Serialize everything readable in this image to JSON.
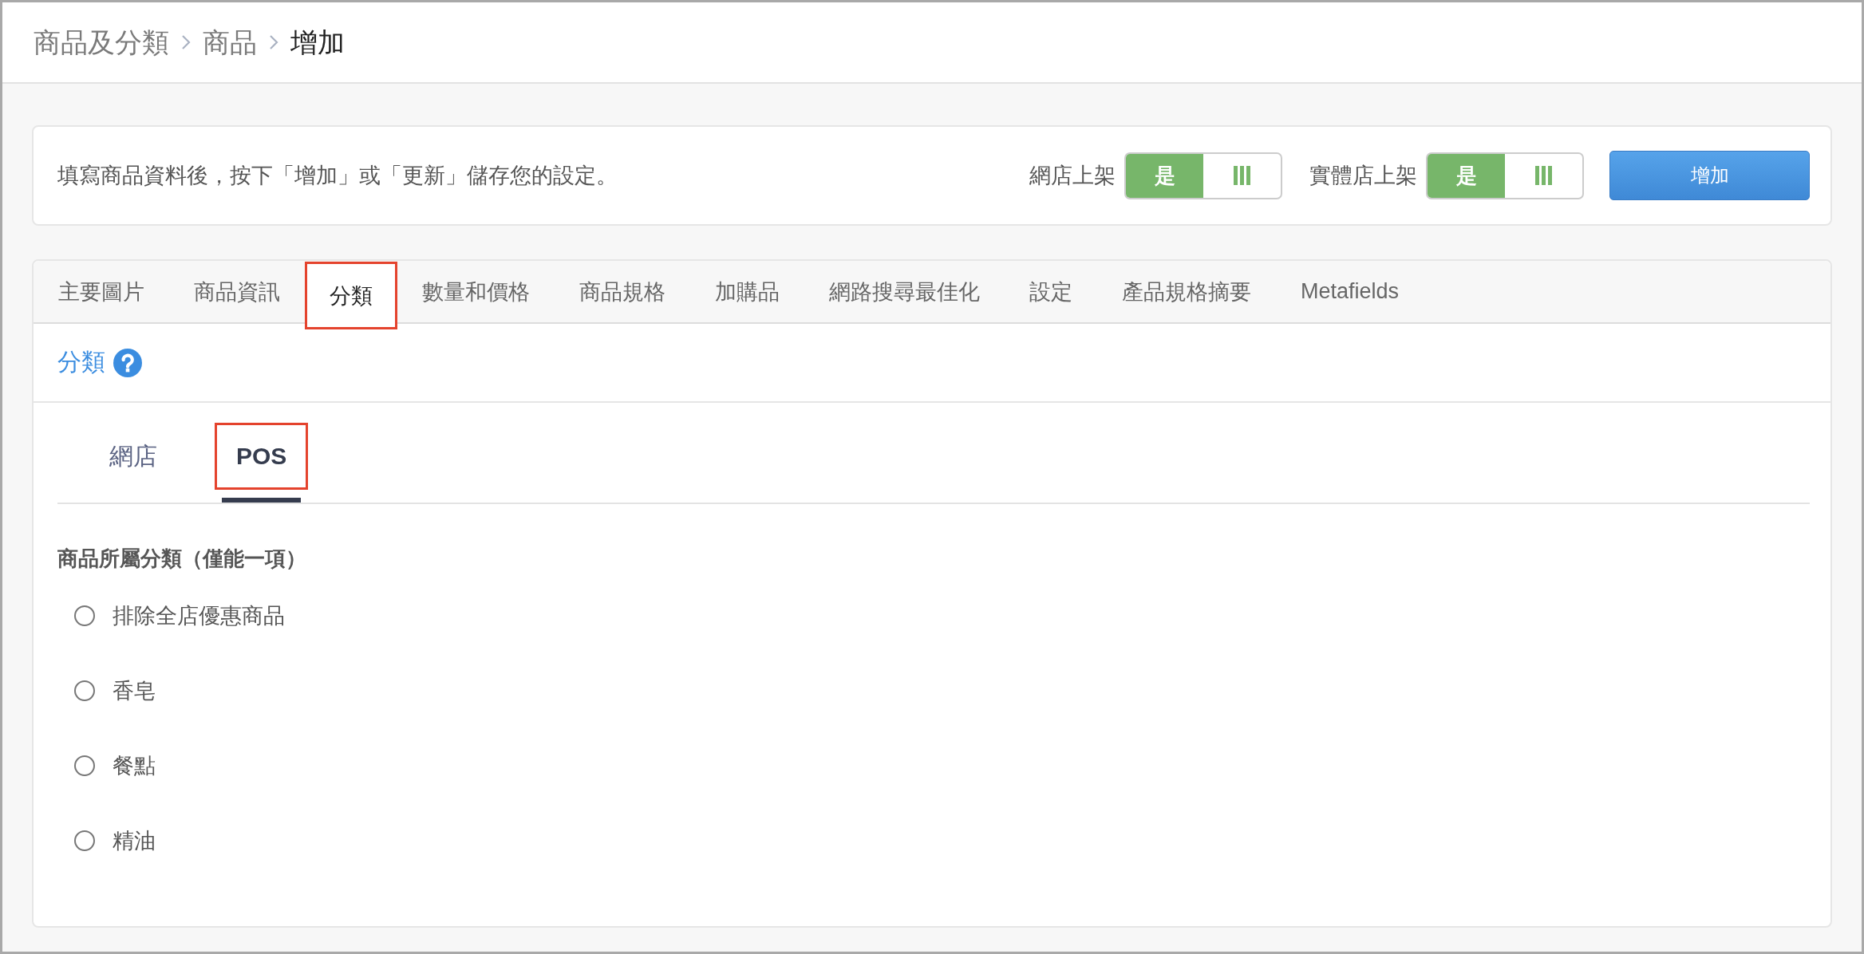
{
  "breadcrumb": [
    {
      "label": "商品及分類",
      "current": false
    },
    {
      "label": "商品",
      "current": false
    },
    {
      "label": "增加",
      "current": true
    }
  ],
  "info_bar": {
    "message": "填寫商品資料後，按下「增加」或「更新」儲存您的設定。",
    "toggles": [
      {
        "label": "網店上架",
        "on": true,
        "on_text": "是"
      },
      {
        "label": "實體店上架",
        "on": true,
        "on_text": "是"
      }
    ],
    "submit_button": "增加"
  },
  "tabs": [
    {
      "label": "主要圖片",
      "selected": false,
      "highlighted": false
    },
    {
      "label": "商品資訊",
      "selected": false,
      "highlighted": false
    },
    {
      "label": "分類",
      "selected": true,
      "highlighted": true
    },
    {
      "label": "數量和價格",
      "selected": false,
      "highlighted": false
    },
    {
      "label": "商品規格",
      "selected": false,
      "highlighted": false
    },
    {
      "label": "加購品",
      "selected": false,
      "highlighted": false
    },
    {
      "label": "網路搜尋最佳化",
      "selected": false,
      "highlighted": false
    },
    {
      "label": "設定",
      "selected": false,
      "highlighted": false
    },
    {
      "label": "產品規格摘要",
      "selected": false,
      "highlighted": false
    },
    {
      "label": "Metafields",
      "selected": false,
      "highlighted": false
    }
  ],
  "section": {
    "title": "分類"
  },
  "channel_tabs": [
    {
      "label": "網店",
      "selected": false,
      "highlighted": false
    },
    {
      "label": "POS",
      "selected": true,
      "highlighted": true
    }
  ],
  "category_field": {
    "label": "商品所屬分類（僅能一項）",
    "options": [
      {
        "label": "排除全店優惠商品",
        "selected": false
      },
      {
        "label": "香皂",
        "selected": false
      },
      {
        "label": "餐點",
        "selected": false
      },
      {
        "label": "精油",
        "selected": false
      }
    ]
  }
}
